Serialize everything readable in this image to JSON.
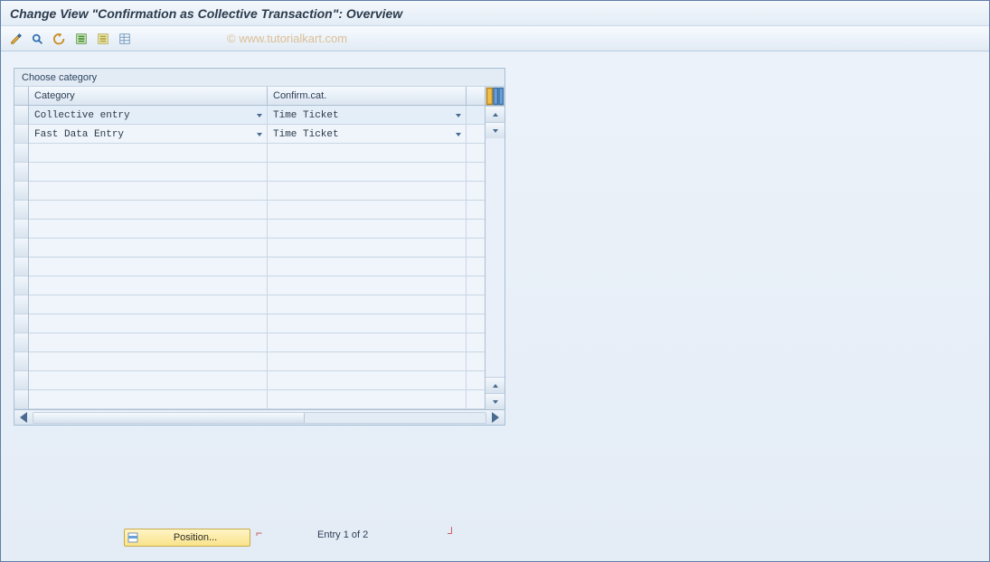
{
  "titlebar": {
    "title": "Change View \"Confirmation as Collective Transaction\": Overview"
  },
  "watermark": "© www.tutorialkart.com",
  "group": {
    "title": "Choose category",
    "columns": {
      "category": "Category",
      "confirm": "Confirm.cat."
    },
    "rows": [
      {
        "category": "Collective entry",
        "confirm": "Time Ticket"
      },
      {
        "category": "Fast Data Entry",
        "confirm": "Time Ticket"
      }
    ],
    "blank_rows": 14
  },
  "footer": {
    "position_label": "Position...",
    "entry_label": "Entry 1 of 2"
  }
}
